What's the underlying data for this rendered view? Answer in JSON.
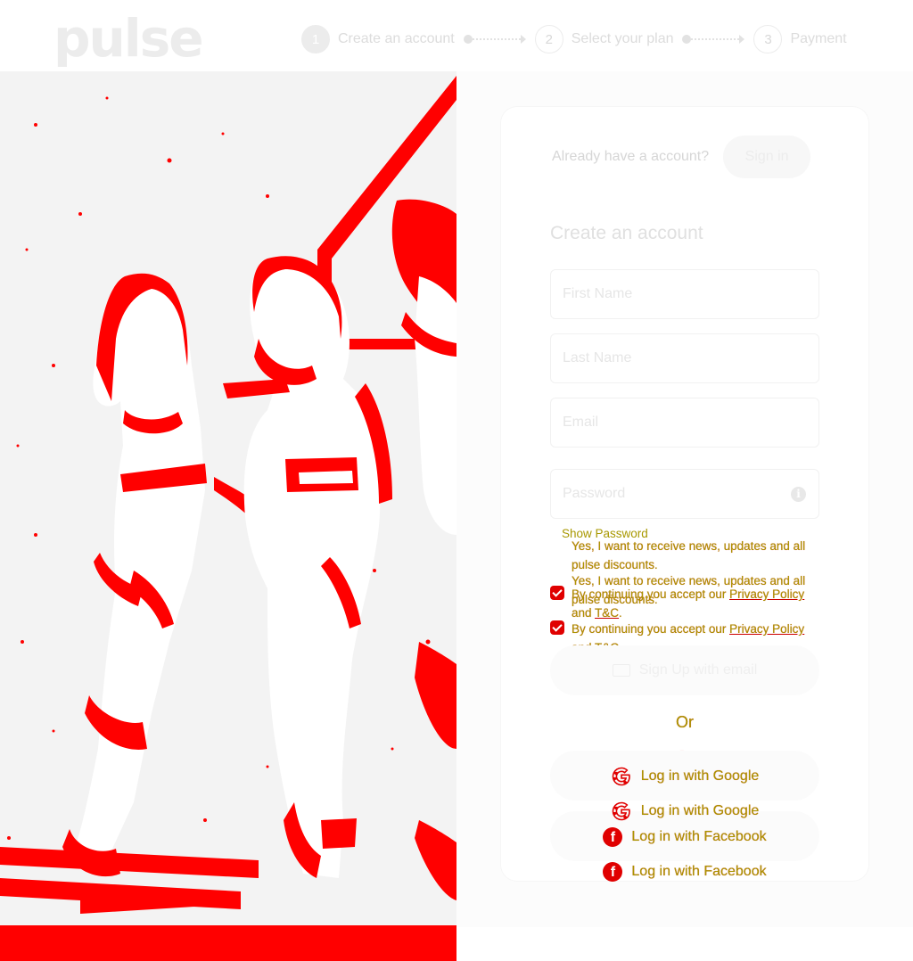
{
  "header": {
    "logo": "pulse",
    "steps": [
      {
        "number": "1",
        "label": "Create an account"
      },
      {
        "number": "2",
        "label": "Select your plan"
      },
      {
        "number": "3",
        "label": "Payment"
      }
    ]
  },
  "signin": {
    "prompt": "Already have a account?",
    "button_label": "Sign in"
  },
  "form": {
    "title": "Create an account",
    "first_name_placeholder": "First Name",
    "last_name_placeholder": "Last Name",
    "email_placeholder": "Email",
    "password_placeholder": "Password",
    "show_password_label": "Show Password",
    "newsletter_text": "Yes, I want to receive news, updates and all pulse discounts.",
    "terms_prefix": "By continuing you accept our",
    "privacy_link": "Privacy Policy",
    "terms_and": "and",
    "tc_link": "T&C",
    "terms_suffix": ".",
    "email_signup_label": "Sign Up with email"
  },
  "divider": {
    "or": "Or"
  },
  "social": {
    "google_label": "Log in with Google",
    "facebook_label": "Log in with Facebook"
  },
  "colors": {
    "accent": "#e00000",
    "label_yellow": "#a89800"
  }
}
